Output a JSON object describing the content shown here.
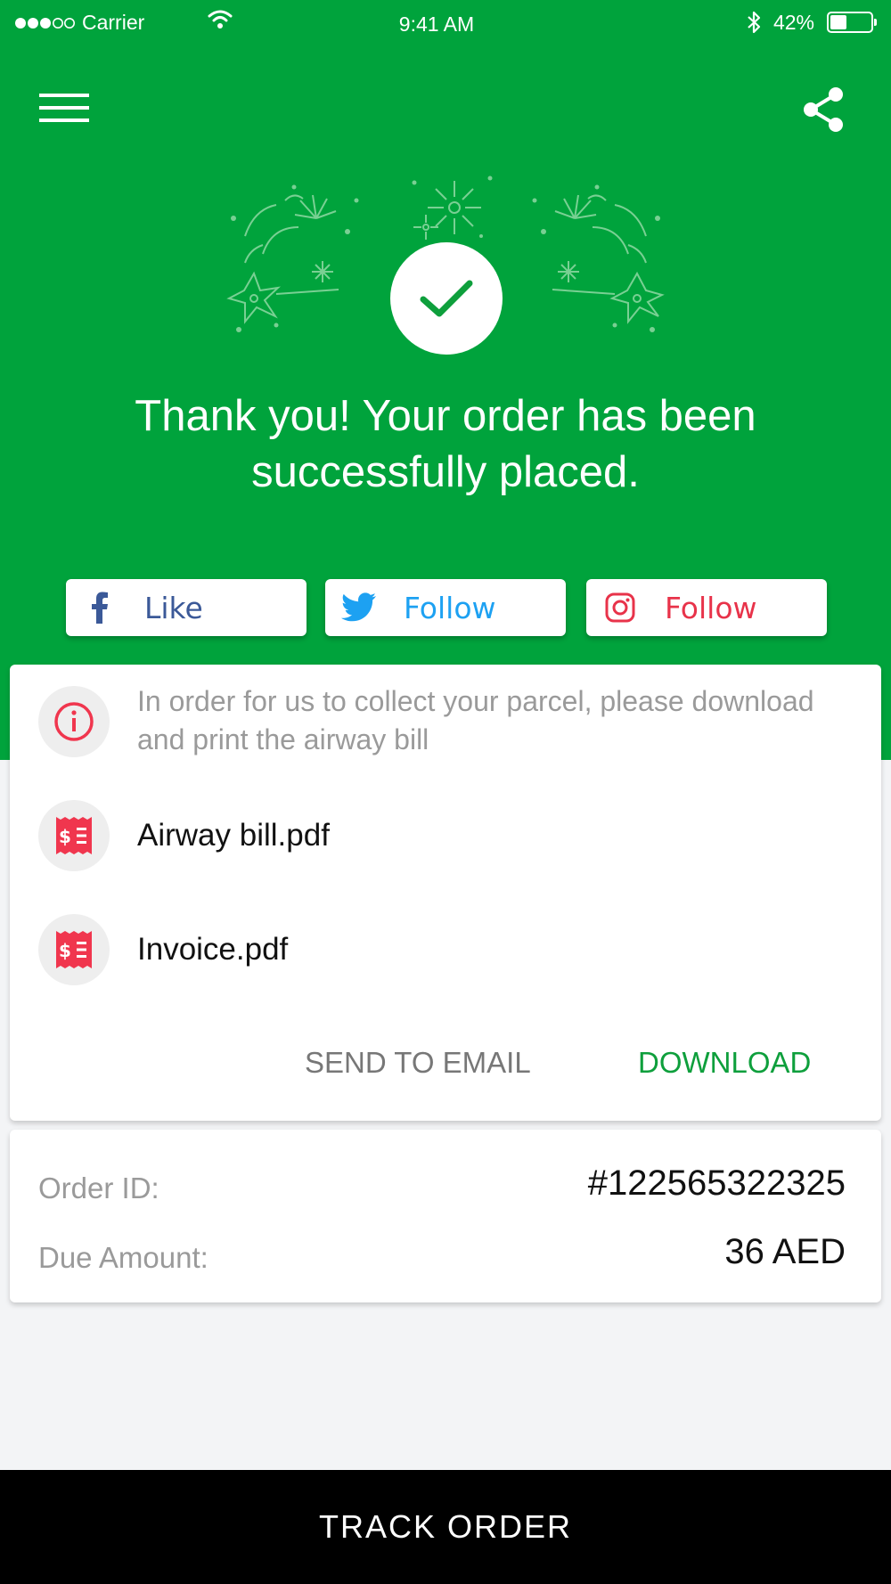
{
  "status_bar": {
    "carrier": "Carrier",
    "time": "9:41 AM",
    "battery_pct": "42%",
    "battery_level": 0.42
  },
  "header": {
    "menu_icon": "hamburger-menu-icon",
    "share_icon": "share-icon"
  },
  "confirmation": {
    "icon": "check-icon",
    "message": "Thank you! Your order has been successfully placed."
  },
  "social": [
    {
      "label": "Like",
      "icon": "facebook-icon",
      "color": "#3b5998"
    },
    {
      "label": "Follow",
      "icon": "twitter-icon",
      "color": "#1da1f2"
    },
    {
      "label": "Follow",
      "icon": "instagram-icon",
      "color": "#e8334a"
    }
  ],
  "documents_card": {
    "info_icon": "info-icon",
    "info_text": "In order for us to collect your parcel, please download and print the airway bill",
    "documents": [
      {
        "name": "Airway bill.pdf",
        "icon": "receipt-icon"
      },
      {
        "name": "Invoice.pdf",
        "icon": "receipt-icon"
      }
    ],
    "send_email_label": "SEND TO EMAIL",
    "download_label": "DOWNLOAD"
  },
  "order": {
    "id_label": "Order ID:",
    "id_value": "#122565322325",
    "amount_label": "Due Amount:",
    "amount_value": "36 AED"
  },
  "footer": {
    "track_label": "TRACK ORDER"
  },
  "colors": {
    "brand_green": "#00a33c",
    "download_green": "#0e9f3c",
    "receipt_red": "#f0364e"
  }
}
